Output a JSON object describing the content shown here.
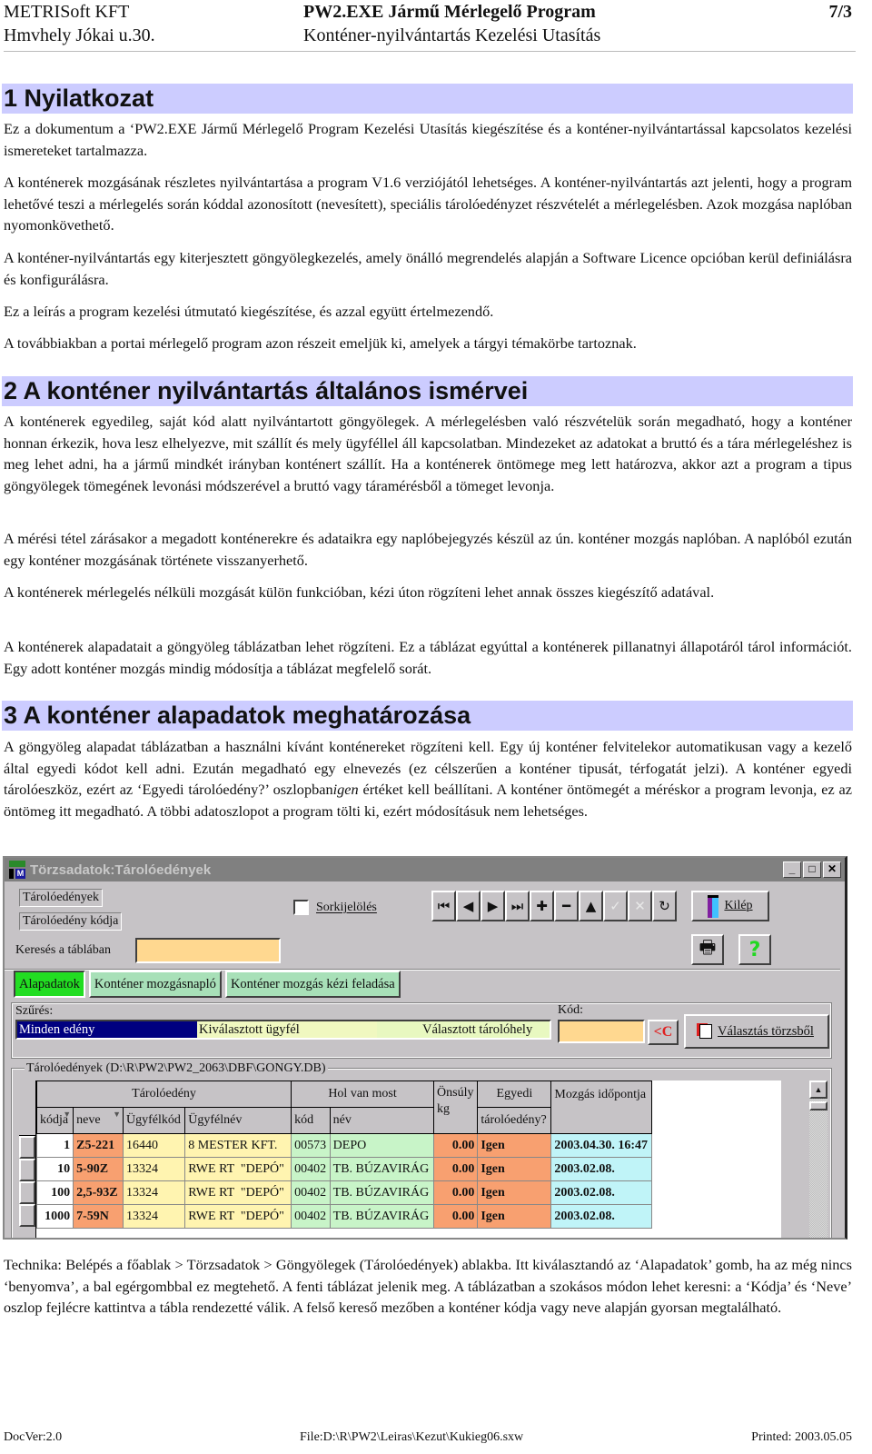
{
  "header": {
    "company": "METRISoft KFT",
    "address": "Hmvhely Jókai u.30.",
    "program_title": "PW2.EXE Jármű Mérlegelő Program",
    "doc_title": "Konténer-nyilvántartás Kezelési Utasítás",
    "page": "7/3"
  },
  "sections": [
    {
      "title": "1 Nyilatkozat",
      "paragraphs": [
        "Ez a dokumentum a ‘PW2.EXE Jármű Mérlegelő Program Kezelési Utasítás kiegészítése és a konténer-nyilvántartással kapcsolatos kezelési ismereteket tartalmazza.",
        "A konténerek mozgásának részletes nyilvántartása a program V1.6 verziójától lehetséges. A konténer-nyilvántartás azt jelenti, hogy a program lehetővé teszi a mérlegelés során kóddal azonosított (nevesített), speciális tárolóedényzet részvételét a mérlegelésben. Azok mozgása naplóban nyomonkövethető.",
        "A konténer-nyilvántartás egy kiterjesztett göngyölegkezelés, amely önálló megrendelés alapján a Software Licence opcióban kerül definiálásra és konfigurálásra.",
        "Ez a leírás a program kezelési útmutató kiegészítése, és azzal együtt értelmezendő.",
        "A továbbiakban a portai mérlegelő program azon részeit emeljük ki, amelyek a tárgyi témakörbe tartoznak."
      ]
    },
    {
      "title": "2 A konténer nyilvántartás általános ismérvei",
      "paragraphs": [
        "A konténerek egyedileg, saját kód alatt nyilvántartott göngyölegek. A mérlegelésben való részvételük során megadható, hogy a konténer honnan érkezik, hova lesz elhelyezve, mit szállít és mely ügyféllel áll kapcsolatban. Mindezeket az adatokat a bruttó és a tára mérlegeléshez is meg lehet adni, ha a jármű mindkét irányban konténert szállít. Ha a konténerek öntömege meg lett határozva, akkor azt a program a tipus göngyölegek tömegének levonási módszerével a bruttó vagy táramérésből a tömeget levonja.",
        "A mérési tétel zárásakor a megadott konténerekre és adataikra egy naplóbejegyzés készül az ún. konténer mozgás naplóban. A naplóból ezután egy konténer mozgásának története visszanyerhető.",
        "A konténerek mérlegelés nélküli mozgását külön funkcióban, kézi úton rögzíteni lehet annak összes kiegészítő adatával.",
        "A konténerek alapadatait a göngyöleg táblázatban lehet rögzíteni. Ez a táblázat egyúttal a konténerek pillanatnyi állapotáról tárol információt. Egy adott konténer mozgás mindig módosítja a táblázat megfelelő sorát."
      ]
    },
    {
      "title": "3 A konténer alapadatok meghatározása",
      "p1_before_italic": "A göngyöleg alapadat táblázatban a használni kívánt konténereket rögzíteni kell. Egy új konténer felvitelekor automatikusan vagy a kezelő által egyedi kódot kell adni. Ezután megadható egy elnevezés (ez célszerűen a konténer tipusát, térfogatát jelzi). A konténer egyedi tárolóeszköz, ezért az ‘Egyedi tárolóedény?’ oszlopban",
      "p1_italic": "igen",
      "p1_after_italic": " értéket kell beállítani. A konténer öntömegét a méréskor a program levonja, ez az öntömeg itt megadható. A többi adatoszlopot a program tölti ki, ezért módosításuk nem lehetséges."
    }
  ],
  "window": {
    "title": "Törzsadatok:Tárolóedények",
    "controls": {
      "minimize": "_",
      "maximize": "□",
      "close": "✕"
    },
    "label_containers": "Tárolóedények",
    "label_container_code": "Tárolóedény kódja",
    "search_label": "Keresés a táblában",
    "search_value": "",
    "row_select_label": "Sorkijelölés",
    "row_select_checked": false,
    "nav_buttons": [
      {
        "name": "first-record-button",
        "glyph": "⏮"
      },
      {
        "name": "prior-record-button",
        "glyph": "◀"
      },
      {
        "name": "next-record-button",
        "glyph": "▶"
      },
      {
        "name": "last-record-button",
        "glyph": "⏭"
      },
      {
        "name": "insert-record-button",
        "glyph": "✚"
      },
      {
        "name": "delete-record-button",
        "glyph": "━"
      },
      {
        "name": "edit-record-button",
        "glyph": "▲"
      },
      {
        "name": "post-record-button",
        "glyph": "✓"
      },
      {
        "name": "cancel-record-button",
        "glyph": "✕"
      },
      {
        "name": "refresh-button",
        "glyph": "↻"
      }
    ],
    "exit_label": "Kilép",
    "print_glyph": "🖶",
    "help_glyph": "?",
    "tabs": [
      {
        "label": "Alapadatok",
        "active": true
      },
      {
        "label": "Konténer mozgásnapló",
        "active": false
      },
      {
        "label": "Konténer mozgás kézi feladása",
        "active": false
      }
    ],
    "filter_label": "Szűrés:",
    "filter_options": [
      {
        "label": "Minden edény",
        "selected": true
      },
      {
        "label": "Kiválasztott ügyfél",
        "selected": false
      },
      {
        "label": "Választott tárolóhely",
        "selected": false
      }
    ],
    "code_label": "Kód:",
    "code_value": "",
    "clear_code_label": "<C",
    "select_from_master_label": "Választás törzsből",
    "group_title": "Tárolóedények (D:\\R\\PW2\\PW2_2063\\DBF\\GONGY.DB)",
    "table": {
      "group_headers": [
        "Tárolóedény",
        "Hol van most",
        "Önsúly kg",
        "Egyedi",
        "Mozgás időpontja"
      ],
      "columns": [
        "kódja",
        "neve",
        "Ügyfélkód",
        "Ügyfélnév",
        "kód",
        "név",
        "tárolóedény?"
      ],
      "rows": [
        {
          "kodja": "1",
          "neve": "Z5-221",
          "ugyfelkod": "16440",
          "ugyfelnev": "8 MESTER KFT.",
          "hely_kod": "00573",
          "hely_nev": "DEPO",
          "onsuly": "0.00",
          "egyedi": "Igen",
          "mozgas": "2003.04.30. 16:47"
        },
        {
          "kodja": "10",
          "neve": "5-90Z",
          "ugyfelkod": "13324",
          "ugyfelnev": "RWE RT  \"DEPÓ\"",
          "hely_kod": "00402",
          "hely_nev": "TB. BÚZAVIRÁG",
          "onsuly": "0.00",
          "egyedi": "Igen",
          "mozgas": "2003.02.08."
        },
        {
          "kodja": "100",
          "neve": "2,5-93Z",
          "ugyfelkod": "13324",
          "ugyfelnev": "RWE RT  \"DEPÓ\"",
          "hely_kod": "00402",
          "hely_nev": "TB. BÚZAVIRÁG",
          "onsuly": "0.00",
          "egyedi": "Igen",
          "mozgas": "2003.02.08."
        },
        {
          "kodja": "1000",
          "neve": "7-59N",
          "ugyfelkod": "13324",
          "ugyfelnev": "RWE RT  \"DEPÓ\"",
          "hely_kod": "00402",
          "hely_nev": "TB. BÚZAVIRÁG",
          "onsuly": "0.00",
          "egyedi": "Igen",
          "mozgas": "2003.02.08."
        }
      ]
    },
    "colors": {
      "active_tab": "#22dd22",
      "inactive_tab": "#a8e0b8",
      "input_bg": "#ffd890",
      "filter_selected": "#000080",
      "filter_bg": "#f0f8c0",
      "col_name": "#f8a070",
      "col_client": "#fff4b0",
      "col_location": "#c8f4c8",
      "col_weight": "#f8a070",
      "col_time": "#c0f4f8"
    }
  },
  "technika": "Technika: Belépés a főablak > Törzsadatok > Göngyölegek (Tárolóedények) ablakba. Itt kiválasztandó az ‘Alapadatok’ gomb, ha az még nincs ‘benyomva’, a bal egérgombbal ez megtehető. A fenti táblázat jelenik meg. A táblázatban a szokásos módon lehet keresni: a ‘Kódja’ és ‘Neve’ oszlop fejlécre kattintva a tábla rendezetté válik. A felső kereső mezőben a konténer kódja vagy neve alapján gyorsan megtalálható.",
  "footer": {
    "doc_version": "DocVer:2.0",
    "file": "File:D:\\R\\PW2\\Leiras\\Kezut\\Kukieg06.sxw",
    "printed": "Printed: 2003.05.05"
  }
}
